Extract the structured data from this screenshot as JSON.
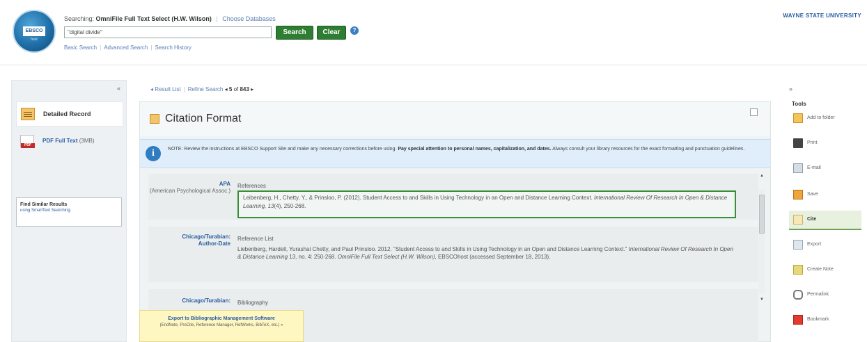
{
  "header": {
    "logo_text": "EBSCO",
    "logo_sub": "host",
    "searching_prefix": "Searching:",
    "database": "OmniFile Full Text Select (H.W. Wilson)",
    "choose_databases": "Choose Databases",
    "search_value": "\"digital divide\"",
    "search_button": "Search",
    "clear_button": "Clear",
    "help_glyph": "?",
    "links": [
      "Basic Search",
      "Advanced Search",
      "Search History"
    ],
    "university": "WAYNE STATE UNIVERSITY"
  },
  "left": {
    "collapse": "«",
    "items": [
      {
        "label": "Detailed Record",
        "icon": "record-icon"
      },
      {
        "label": "PDF Full Text",
        "count": "(3MB)",
        "icon": "pdf-icon"
      }
    ],
    "similar_title": "Find Similar Results",
    "similar_sub": "using SmartText Searching."
  },
  "nav": {
    "result_list": "Result List",
    "refine_search": "Refine Search",
    "prev": "◂",
    "position": "5",
    "of": "of",
    "total": "843",
    "next": "▸"
  },
  "panel": {
    "title": "Citation Format",
    "note_prefix": "NOTE: Review the instructions at EBSCO Support Site and make any necessary corrections before using.",
    "note_bold": "Pay special attention to personal names, capitalization, and dates.",
    "note_suffix": "Always consult your library resources for the exact formatting and punctuation guidelines."
  },
  "citations": [
    {
      "style": "APA",
      "style_sub": "(American Psychological Assoc.)",
      "heading": "References",
      "text_plain": "Leibenberg, H., Chetty, Y., & Prinsloo, P. (2012). Student Access to and Skills in Using Technology in an Open and Distance Learning Context.",
      "text_italic": "International Review Of Research In Open & Distance Learning, 13",
      "text_end": "(4), 250-268."
    },
    {
      "style": "Chicago/Turabian:",
      "style_sub": "Author-Date",
      "heading": "Reference List",
      "text_plain": "Liebenberg, Hardell, Yurashai Chetty, and Paul Prinsloo. 2012. \"Student Access to and Skills in Using Technology in an Open and Distance Learning Context.\"",
      "text_italic": "International Review Of Research In Open & Distance Learning",
      "text_mid": "13, no. 4: 250-268.",
      "text_italic2": "OmniFile Full Text Select (H.W. Wilson)",
      "text_end": ", EBSCOhost (accessed September 18, 2013)."
    },
    {
      "style": "Chicago/Turabian:",
      "heading": "Bibliography"
    }
  ],
  "export": {
    "title": "Export to Bibliographic Management Software",
    "sub": "(EndNote, ProCite, Reference Manager, RefWorks, BibTeX, etc.) »"
  },
  "tools": {
    "collapse": "»",
    "title": "Tools",
    "items": [
      {
        "label": "Add to folder",
        "icon": "folder-icon"
      },
      {
        "label": "Print",
        "icon": "print-icon"
      },
      {
        "label": "E-mail",
        "icon": "email-icon"
      },
      {
        "label": "Save",
        "icon": "save-icon"
      },
      {
        "label": "Cite",
        "icon": "cite-icon",
        "active": true
      },
      {
        "label": "Export",
        "icon": "export-icon"
      },
      {
        "label": "Create Note",
        "icon": "note-icon"
      },
      {
        "label": "Permalink",
        "icon": "permalink-icon"
      },
      {
        "label": "Bookmark",
        "icon": "bookmark-icon"
      }
    ]
  },
  "scroll": {
    "up": "▲",
    "down": "▼"
  },
  "colors": {
    "accent_green": "#2e7d32",
    "link_blue": "#2a5d9f",
    "note_bg": "#dfeefa",
    "export_bg": "#fff7c2"
  }
}
